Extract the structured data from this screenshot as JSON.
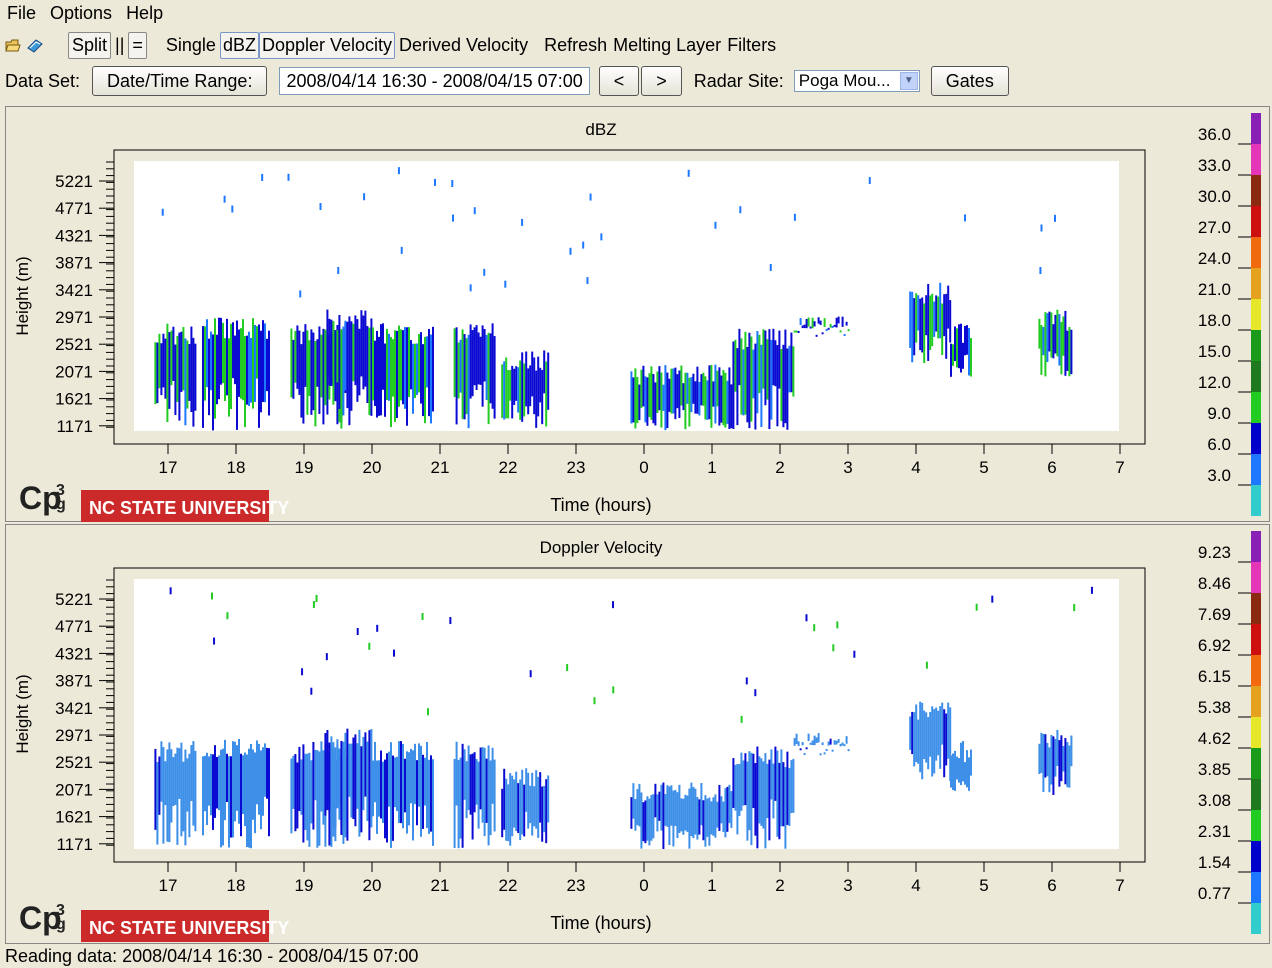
{
  "menu": [
    "File",
    "Options",
    "Help"
  ],
  "toolbar": {
    "split": "Split",
    "vertical_split": "||",
    "horizontal_split": "=",
    "single": "Single",
    "dbz": "dBZ",
    "doppler": "Doppler Velocity",
    "derived": "Derived Velocity",
    "refresh": "Refresh",
    "melting": "Melting Layer",
    "filters": "Filters"
  },
  "dataset": {
    "label": "Data Set:",
    "range_button": "Date/Time Range:",
    "range_value": "2008/04/14 16:30 - 2008/04/15 07:00",
    "prev": "<",
    "next": ">",
    "site_label": "Radar Site:",
    "site_value": "Poga Mou...",
    "gates": "Gates"
  },
  "plots": [
    {
      "title": "dBZ",
      "ylabel": "Height (m)",
      "xlabel": "Time (hours)",
      "yticks": [
        "5221",
        "4771",
        "4321",
        "3871",
        "3421",
        "2971",
        "2521",
        "2071",
        "1621",
        "1171"
      ],
      "xticks": [
        "17",
        "18",
        "19",
        "20",
        "21",
        "22",
        "23",
        "0",
        "1",
        "2",
        "3",
        "4",
        "5",
        "6",
        "7"
      ],
      "scale": [
        "36.0",
        "33.0",
        "30.0",
        "27.0",
        "24.0",
        "21.0",
        "18.0",
        "15.0",
        "12.0",
        "9.0",
        "6.0",
        "3.0"
      ],
      "scale_colors": [
        "#8a1fb5",
        "#e636b8",
        "#8b2a10",
        "#cc1010",
        "#f26a10",
        "#e6a11e",
        "#e6e62a",
        "#1a9a1a",
        "#1f7a1f",
        "#22cc22",
        "#0000cc",
        "#1e78ff",
        "#33cccc"
      ]
    },
    {
      "title": "Doppler Velocity",
      "ylabel": "Height (m)",
      "xlabel": "Time (hours)",
      "yticks": [
        "5221",
        "4771",
        "4321",
        "3871",
        "3421",
        "2971",
        "2521",
        "2071",
        "1621",
        "1171"
      ],
      "xticks": [
        "17",
        "18",
        "19",
        "20",
        "21",
        "22",
        "23",
        "0",
        "1",
        "2",
        "3",
        "4",
        "5",
        "6",
        "7"
      ],
      "scale": [
        "9.23",
        "8.46",
        "7.69",
        "6.92",
        "6.15",
        "5.38",
        "4.62",
        "3.85",
        "3.08",
        "2.31",
        "1.54",
        "0.77"
      ],
      "scale_colors": [
        "#8a1fb5",
        "#e636b8",
        "#8b2a10",
        "#cc1010",
        "#f26a10",
        "#e6a11e",
        "#e6e62a",
        "#1a9a1a",
        "#1f7a1f",
        "#22cc22",
        "#0000cc",
        "#1e78ff",
        "#33cccc"
      ]
    }
  ],
  "logo": {
    "cpg": "Cp",
    "sup": "3",
    "sub": "g",
    "university": "NC STATE UNIVERSITY"
  },
  "status": "Reading data: 2008/04/14 16:30 - 2008/04/15 07:00"
}
